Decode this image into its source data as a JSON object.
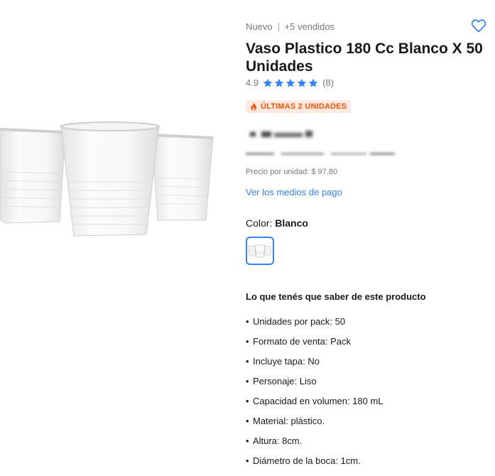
{
  "product": {
    "condition": "Nuevo",
    "sold": "+5 vendidos",
    "title": "Vaso Plastico 180 Cc Blanco X 50 Unidades",
    "rating": {
      "score": "4.9",
      "stars": 5,
      "count": "(8)"
    },
    "badge": "ÚLTIMAS 2 UNIDADES",
    "unit_price": "Precio por unidad: $ 97,80",
    "payment_link": "Ver los medios de pago",
    "color": {
      "label": "Color: ",
      "value": "Blanco"
    },
    "features_title": "Lo que tenés que saber de este producto",
    "features": [
      "Unidades por pack: 50",
      "Formato de venta: Pack",
      "Incluye tapa: No",
      "Personaje: Liso",
      "Capacidad en volumen: 180 mL",
      "Material: plástico.",
      "Altura: 8cm.",
      "Diámetro de la boca: 1cm."
    ]
  },
  "colors": {
    "accent": "#3483fa",
    "badge_text": "#f0560a",
    "badge_bg": "#ffe9e0",
    "star": "#3483fa"
  },
  "icons": {
    "favorite": "heart-outline-icon",
    "star": "star-icon",
    "flame": "flame-icon"
  }
}
